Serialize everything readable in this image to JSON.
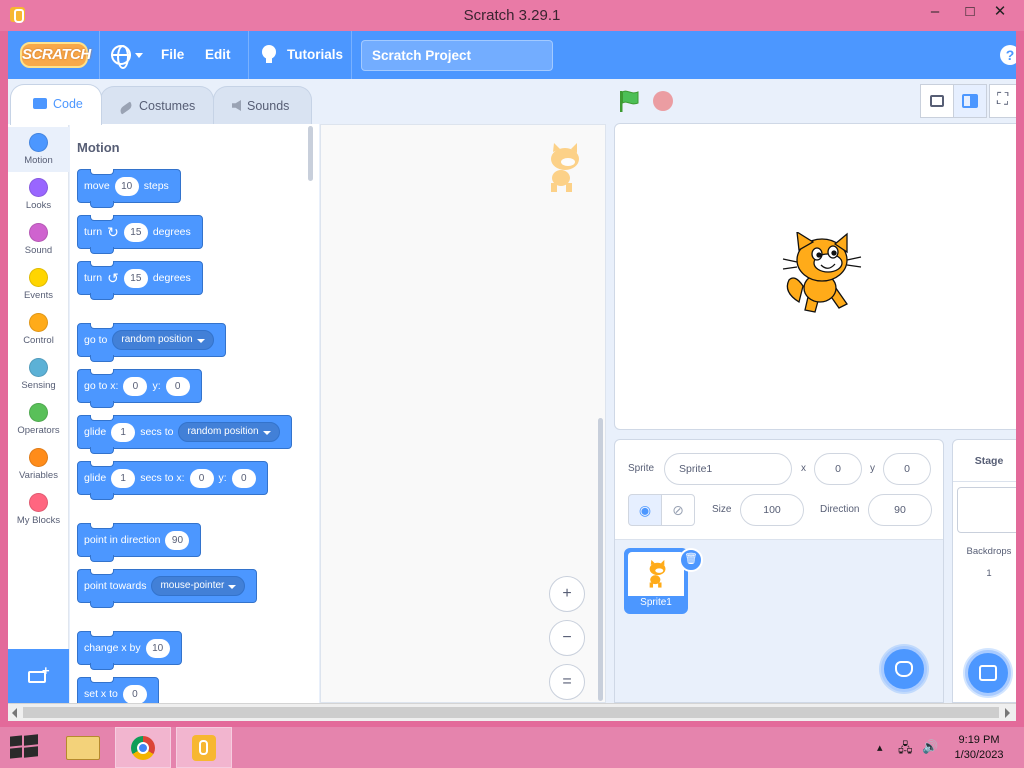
{
  "window": {
    "title": "Scratch 3.29.1",
    "minimize": "–",
    "maximize": "□",
    "close": "✕"
  },
  "menubar": {
    "logo": "SCRATCH",
    "file": "File",
    "edit": "Edit",
    "tutorials": "Tutorials",
    "project_title": "Scratch Project",
    "help": "?"
  },
  "tabs": [
    {
      "label": "Code"
    },
    {
      "label": "Costumes"
    },
    {
      "label": "Sounds"
    }
  ],
  "categories": [
    {
      "label": "Motion",
      "color": "#4c97ff"
    },
    {
      "label": "Looks",
      "color": "#9966ff"
    },
    {
      "label": "Sound",
      "color": "#cf63cf"
    },
    {
      "label": "Events",
      "color": "#ffd500"
    },
    {
      "label": "Control",
      "color": "#ffab19"
    },
    {
      "label": "Sensing",
      "color": "#5cb1d6"
    },
    {
      "label": "Operators",
      "color": "#59c059"
    },
    {
      "label": "Variables",
      "color": "#ff8c1a"
    },
    {
      "label": "My Blocks",
      "color": "#ff6680"
    }
  ],
  "palette": {
    "section": "Motion",
    "blocks": {
      "move": {
        "a": "move",
        "v": "10",
        "b": "steps"
      },
      "turn_right": {
        "a": "turn",
        "v": "15",
        "b": "degrees"
      },
      "turn_left": {
        "a": "turn",
        "v": "15",
        "b": "degrees"
      },
      "goto": {
        "a": "go to",
        "d": "random position"
      },
      "gotoxy": {
        "a": "go to x:",
        "x": "0",
        "b": "y:",
        "y": "0"
      },
      "glide_to": {
        "a": "glide",
        "v": "1",
        "b": "secs to",
        "d": "random position"
      },
      "glide_xy": {
        "a": "glide",
        "v": "1",
        "b": "secs to x:",
        "x": "0",
        "c": "y:",
        "y": "0"
      },
      "point_dir": {
        "a": "point in direction",
        "v": "90"
      },
      "point_towards": {
        "a": "point towards",
        "d": "mouse-pointer"
      },
      "change_x": {
        "a": "change x by",
        "v": "10"
      },
      "set_x": {
        "a": "set x to",
        "v": "0"
      }
    }
  },
  "zoom": {
    "in": "+",
    "out": "−",
    "reset": "="
  },
  "sprite_info": {
    "sprite_label": "Sprite",
    "sprite_name": "Sprite1",
    "x_label": "x",
    "x": "0",
    "y_label": "y",
    "y": "0",
    "size_label": "Size",
    "size": "100",
    "direction_label": "Direction",
    "direction": "90"
  },
  "sprites": [
    {
      "name": "Sprite1"
    }
  ],
  "stage_pane": {
    "title": "Stage",
    "backdrops_label": "Backdrops",
    "backdrops_count": "1"
  },
  "taskbar": {
    "time": "9:19 PM",
    "date": "1/30/2023"
  },
  "colors": {
    "accent": "#4c97ff",
    "titlebar": "#e97aa6",
    "taskbar": "#e584ad"
  }
}
